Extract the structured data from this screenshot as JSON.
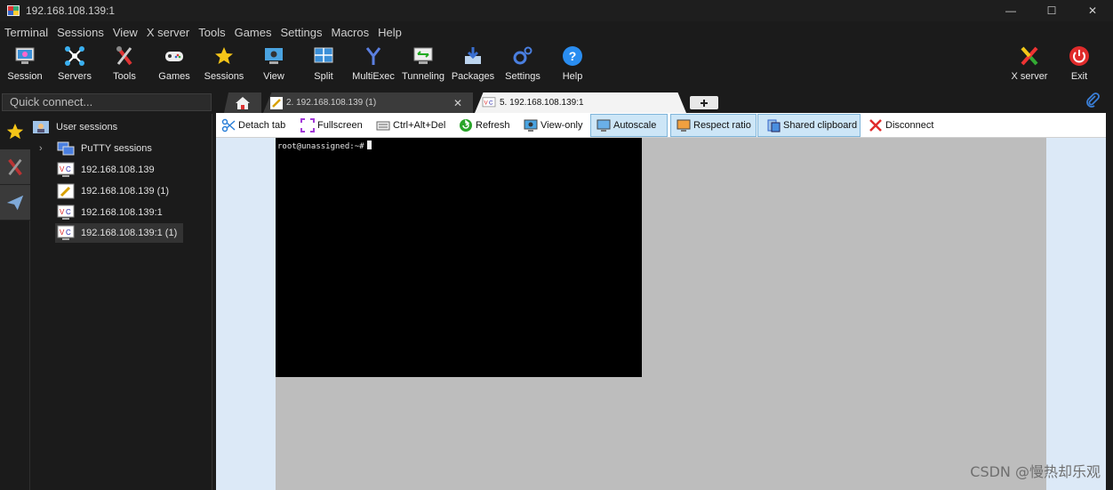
{
  "window": {
    "title": "192.168.108.139:1",
    "controls": {
      "minimize": "—",
      "maximize": "☐",
      "close": "✕"
    }
  },
  "menu": [
    "Terminal",
    "Sessions",
    "View",
    "X server",
    "Tools",
    "Games",
    "Settings",
    "Macros",
    "Help"
  ],
  "toolbar": {
    "session": "Session",
    "servers": "Servers",
    "tools": "Tools",
    "games": "Games",
    "sessions": "Sessions",
    "view": "View",
    "split": "Split",
    "multiexec": "MultiExec",
    "tunneling": "Tunneling",
    "packages": "Packages",
    "settings": "Settings",
    "help": "Help",
    "xserver": "X server",
    "exit": "Exit"
  },
  "quick_connect": {
    "placeholder": "Quick connect..."
  },
  "tree": {
    "root": "User sessions",
    "putty": "PuTTY sessions",
    "items": [
      "192.168.108.139",
      "192.168.108.139 (1)",
      "192.168.108.139:1",
      "192.168.108.139:1 (1)"
    ]
  },
  "tabs": {
    "tab2": "2. 192.168.108.139 (1)",
    "tab5": "5. 192.168.108.139:1",
    "close": "✕"
  },
  "session_toolbar": {
    "detach": "Detach tab",
    "fullscreen": "Fullscreen",
    "cad": "Ctrl+Alt+Del",
    "refresh": "Refresh",
    "viewonly": "View-only",
    "autoscale": "Autoscale",
    "ratio": "Respect ratio",
    "clipboard": "Shared clipboard",
    "disconnect": "Disconnect"
  },
  "terminal": {
    "prompt": "root@unassigned:~#"
  },
  "watermark": "CSDN @慢热却乐观"
}
